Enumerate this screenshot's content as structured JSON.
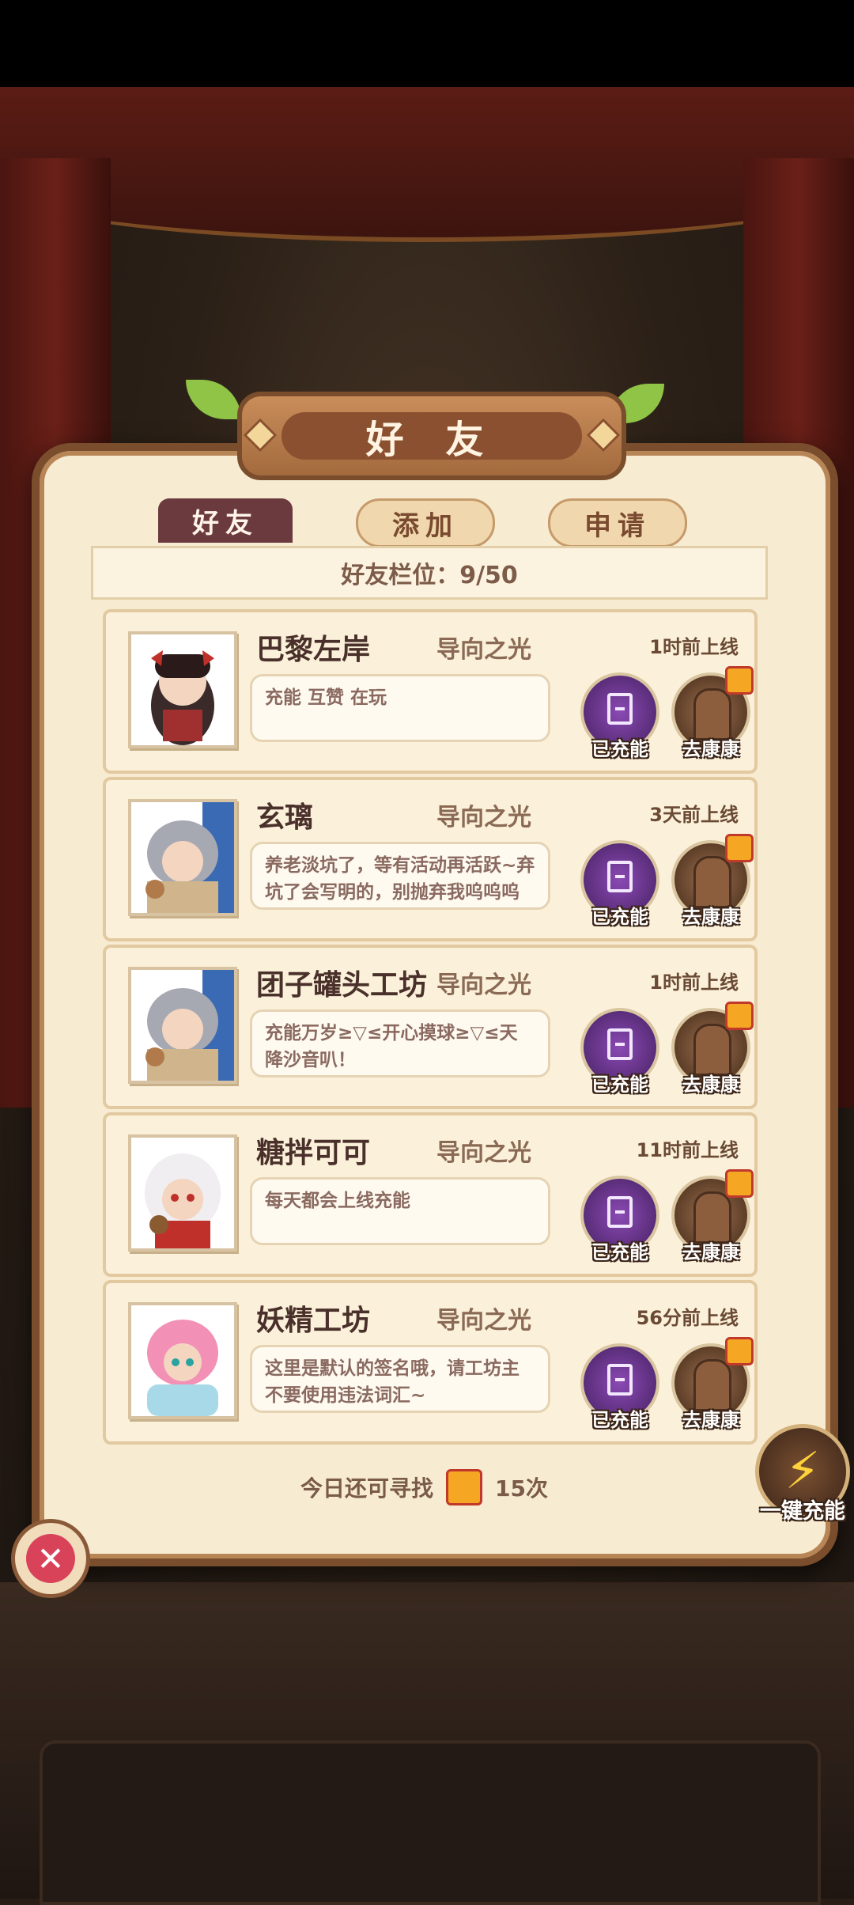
{
  "title": "好 友",
  "tabs": {
    "friends": "好友",
    "add": "添加",
    "apply": "申请"
  },
  "slots": "好友栏位：9/50",
  "friends": [
    {
      "name": "巴黎左岸",
      "guild": "导向之光",
      "online": "1时前上线",
      "signature": "充能 互赞 在玩",
      "charge_label": "已充能",
      "visit_label": "去康康"
    },
    {
      "name": "玄璃",
      "guild": "导向之光",
      "online": "3天前上线",
      "signature": "养老淡坑了，等有活动再活跃~弃坑了会写明的，别抛弃我呜呜呜",
      "charge_label": "已充能",
      "visit_label": "去康康"
    },
    {
      "name": "团子罐头工坊",
      "guild": "导向之光",
      "online": "1时前上线",
      "signature": "充能万岁≥▽≤开心摸球≥▽≤天降沙音叭！",
      "charge_label": "已充能",
      "visit_label": "去康康"
    },
    {
      "name": "糖拌可可",
      "guild": "导向之光",
      "online": "11时前上线",
      "signature": "每天都会上线充能",
      "charge_label": "已充能",
      "visit_label": "去康康"
    },
    {
      "name": "妖精工坊",
      "guild": "导向之光",
      "online": "56分前上线",
      "signature": "这里是默认的签名哦，请工坊主不要使用违法词汇~",
      "charge_label": "已充能",
      "visit_label": "去康康"
    }
  ],
  "footer": {
    "prefix": "今日还可寻找",
    "count": "15次"
  },
  "one_key_label": "一键充能",
  "colors": {
    "accent": "#6b3a3e",
    "panel": "#f7ecd2",
    "charge": "#5a2d7a"
  }
}
